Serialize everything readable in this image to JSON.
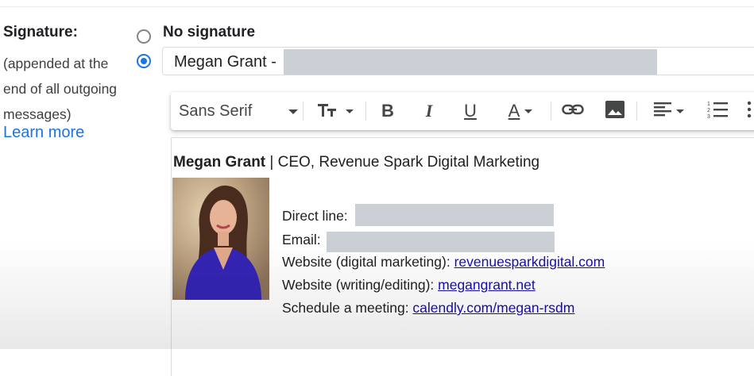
{
  "labels": {
    "signature": "Signature:",
    "description_lines": [
      "(appended at the",
      "end of all outgoing",
      "messages)"
    ],
    "learn_more": "Learn more"
  },
  "options": {
    "no_signature": "No signature",
    "selected_signature": "Megan Grant -"
  },
  "toolbar": {
    "font_family": "Sans Serif",
    "icons": [
      "text-size-icon",
      "bold-icon",
      "italic-icon",
      "underline-icon",
      "text-color-icon",
      "link-icon",
      "image-icon",
      "align-icon",
      "numbered-list-icon",
      "more-icon"
    ],
    "bold": "B",
    "italic": "I",
    "underline": "U",
    "text_color": "A"
  },
  "signature": {
    "name": "Megan Grant",
    "title": " | CEO, Revenue Spark Digital Marketing",
    "direct_line_label": "Direct line:",
    "email_label": "Email:",
    "website_marketing_label": "Website (digital marketing): ",
    "website_marketing_link": "revenuesparkdigital.com",
    "website_writing_label": "Website (writing/editing): ",
    "website_writing_link": "megangrant.net",
    "meeting_label": "Schedule a meeting: ",
    "meeting_link": "calendly.com/megan-rsdm"
  },
  "colors": {
    "accent": "#1a73e8",
    "link": "#1a0dab",
    "redaction": "#cbd0d6"
  }
}
